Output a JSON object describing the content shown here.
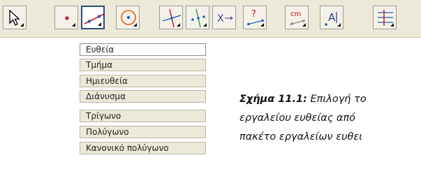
{
  "toolbar": {
    "tools": [
      {
        "icon": "move-pointer-icon"
      },
      {
        "icon": "new-point-icon"
      },
      {
        "icon": "line-through-two-points-icon",
        "active": true
      },
      {
        "icon": "circle-with-center-icon"
      },
      {
        "icon": "perpendicular-line-icon"
      },
      {
        "icon": "midpoint-line-icon"
      },
      {
        "icon": "intersect-icon",
        "label": "X"
      },
      {
        "icon": "relation-question-icon",
        "label": "?"
      },
      {
        "icon": "distance-cm-icon",
        "label": "cm"
      },
      {
        "icon": "insert-text-icon",
        "label": "A"
      },
      {
        "icon": "slider-icon"
      }
    ]
  },
  "menu": {
    "items": [
      {
        "label": "Ευθεία",
        "selected": true
      },
      {
        "label": "Τμήμα"
      },
      {
        "label": "Ημιευθεία"
      },
      {
        "label": "Διάνυσμα"
      },
      {
        "label": "Τρίγωνο"
      },
      {
        "label": "Πολύγωνο"
      },
      {
        "label": "Κανονικό πολύγωνο"
      }
    ]
  },
  "caption": {
    "figure_label": "Σχήμα 11.1:",
    "line1": "Επιλογή το",
    "line2": "εργαλείου ευθείας από",
    "line3": "πακέτο εργαλείων ευθει"
  },
  "colors": {
    "toolbar_bg": "#ece9d8",
    "accent": "#2b4a7e",
    "point_red": "#d6001c",
    "line_blue": "#1f5fbf",
    "circle_orange": "#e85a1a"
  }
}
